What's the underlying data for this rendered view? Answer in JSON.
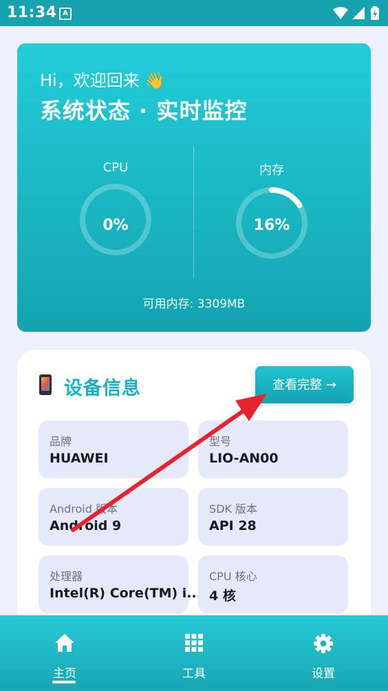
{
  "status_bar": {
    "time": "11:34",
    "notification_letter": "A"
  },
  "hero": {
    "greeting": "Hi，欢迎回来 👋",
    "title": "系统状态 · 实时监控",
    "cpu": {
      "label": "CPU",
      "value_text": "0%",
      "percent": 0
    },
    "memory": {
      "label": "内存",
      "value_text": "16%",
      "percent": 16
    },
    "available_memory": "可用内存: 3309MB",
    "gradient_colors": [
      "#22cdd9",
      "#13a4b0"
    ]
  },
  "device": {
    "title": "设备信息",
    "view_full_label": "查看完整 →",
    "items": [
      {
        "key": "品牌",
        "value": "HUAWEI"
      },
      {
        "key": "型号",
        "value": "LIO-AN00"
      },
      {
        "key": "Android 版本",
        "value": "Android 9"
      },
      {
        "key": "SDK 版本",
        "value": "API 28"
      },
      {
        "key": "处理器",
        "value": "Intel(R) Core(TM) i..."
      },
      {
        "key": "CPU 核心",
        "value": "4 核"
      }
    ]
  },
  "bottom_nav": {
    "items": [
      {
        "label": "主页",
        "icon": "home-icon",
        "active": true
      },
      {
        "label": "工具",
        "icon": "grid-icon",
        "active": false
      },
      {
        "label": "设置",
        "icon": "gear-icon",
        "active": false
      }
    ]
  },
  "colors": {
    "accent": "#18b3c2",
    "annotation_arrow": "#e8232f"
  }
}
